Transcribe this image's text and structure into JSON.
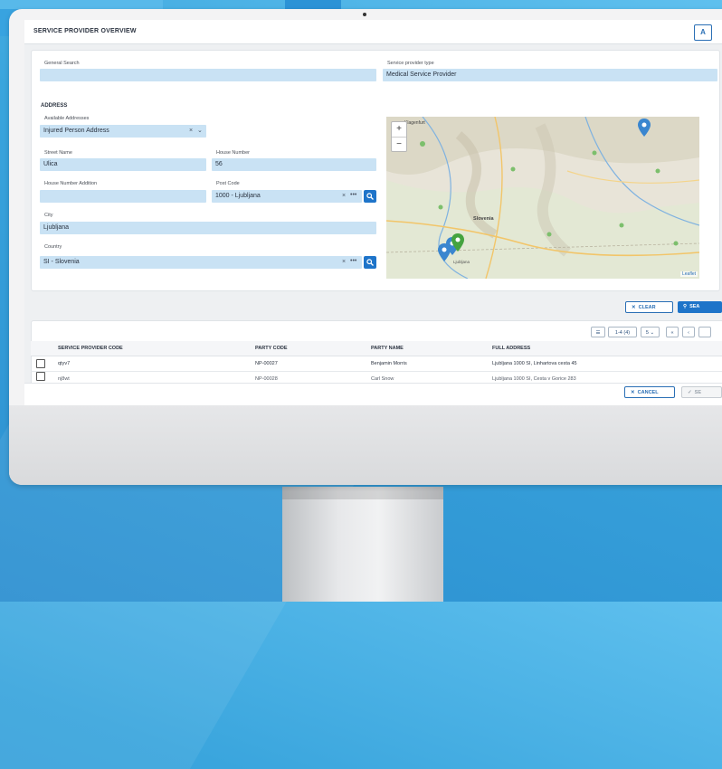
{
  "window": {
    "title": "SERVICE PROVIDER OVERVIEW",
    "corner_button": "A"
  },
  "search": {
    "general_label": "General Search",
    "general_value": "",
    "type_label": "Service provider type",
    "type_value": "Medical Service Provider"
  },
  "address": {
    "section_title": "ADDRESS",
    "available_label": "Available Addresses",
    "available_value": "Injured Person Address",
    "street_label": "Street Name",
    "street_value": "Ulica",
    "house_label": "House Number",
    "house_value": "56",
    "addition_label": "House Number Addition",
    "addition_value": "",
    "post_label": "Post Code",
    "post_value": "1000 - Ljubljana",
    "city_label": "City",
    "city_value": "Ljubljana",
    "country_label": "Country",
    "country_value": "SI - Slovenia"
  },
  "map": {
    "zoom_in": "+",
    "zoom_out": "−",
    "attribution": "Leaflet",
    "place_labels": [
      "Klagenfurt",
      "Slovenia",
      "Ljubljana"
    ]
  },
  "actions": {
    "clear": "CLEAR",
    "search": "SEA"
  },
  "pager": {
    "range": "1-4 (4)",
    "page_size": "5",
    "first": "«",
    "prev": "‹"
  },
  "table": {
    "columns": [
      "SERVICE PROVIDER CODE",
      "PARTY CODE",
      "PARTY NAME",
      "FULL ADDRESS"
    ],
    "rows": [
      [
        "qtyv7",
        "NP-00027",
        "Benjamin Morris",
        "Ljubljana 1000 SI, Linhartova cesta 45"
      ],
      [
        "nj8wt",
        "NP-00028",
        "Carl Snow",
        "Ljubljana 1000 SI, Cesta v Gorice 283"
      ]
    ]
  },
  "footer": {
    "cancel": "CANCEL",
    "select": "SE"
  },
  "colors": {
    "accent": "#1e74c9",
    "field": "#c9e2f4",
    "map_pin_blue": "#3a86cf",
    "map_pin_green": "#45a33f"
  }
}
